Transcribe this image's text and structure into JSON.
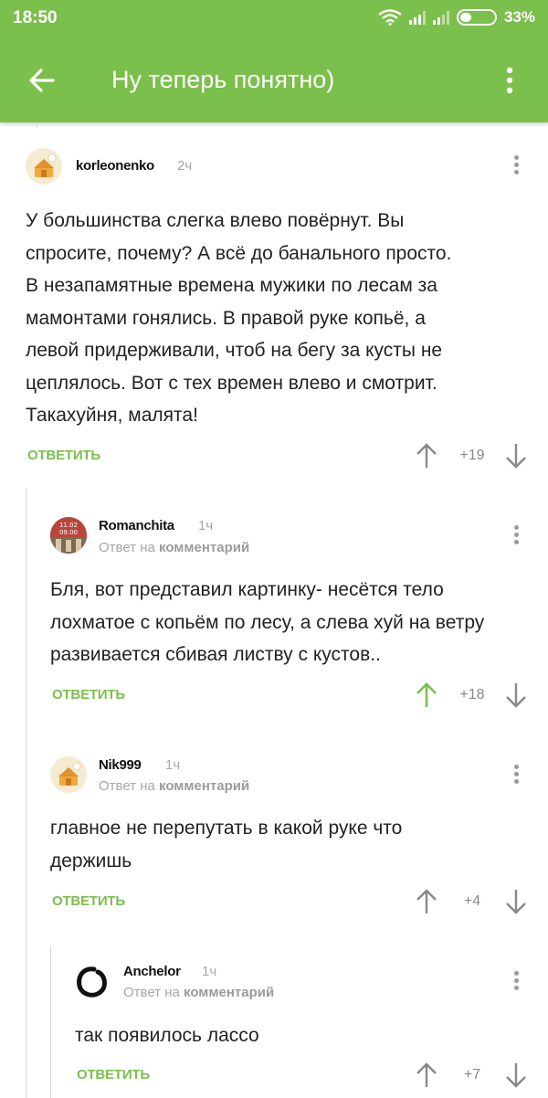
{
  "status_bar": {
    "time": "18:50",
    "battery": "33%",
    "battery_level": 0.33,
    "icons": [
      "wifi-icon",
      "signal-icon",
      "signal-icon",
      "battery-icon"
    ]
  },
  "app_bar": {
    "title": "Ну теперь понятно)",
    "back_icon": "arrow-left-icon",
    "menu_icon": "more-vertical-icon"
  },
  "colors": {
    "accent": "#7bbf4c",
    "upvoted": "#7bbf4c",
    "meta": "#a6a6a6"
  },
  "comments": [
    {
      "username": "korleonenko",
      "time": "2ч",
      "reply_prefix": "",
      "reply_target": "",
      "text": [
        "У большинства слегка влево повёрнут. Вы",
        "спросите, почему? А всё до банального просто.",
        "В незапамятные времена мужики по лесам за",
        "мамонтами гонялись. В правой руке копьё, а",
        "левой придерживали, чтоб на бегу за кусты не",
        "цеплялось. Вот с тех времен влево и смотрит.",
        "Такахуйня, малята!"
      ],
      "reply_label": "ОТВЕТИТЬ",
      "score": "+19",
      "upvoted": false
    },
    {
      "username": "Romanchita",
      "time": "1ч",
      "reply_prefix": "Ответ на",
      "reply_target": "комментарий",
      "text": [
        "Бля, вот представил картинку- несётся тело",
        "лохматое с копьём по лесу, а слева хуй на ветру",
        "развивается сбивая листву с кустов.."
      ],
      "reply_label": "ОТВЕТИТЬ",
      "score": "+18",
      "upvoted": true
    },
    {
      "username": "Nik999",
      "time": "1ч",
      "reply_prefix": "Ответ на",
      "reply_target": "комментарий",
      "text": [
        "главное не перепутать в какой руке что",
        "держишь"
      ],
      "reply_label": "ОТВЕТИТЬ",
      "score": "+4",
      "upvoted": false
    },
    {
      "username": "Anchelor",
      "time": "1ч",
      "reply_prefix": "Ответ на",
      "reply_target": "комментарий",
      "text": [
        "так появилось лассо"
      ],
      "reply_label": "ОТВЕТИТЬ",
      "score": "+7",
      "upvoted": false
    }
  ],
  "avatar_badges": {
    "romanchita": [
      "11.02",
      "09.00"
    ]
  }
}
